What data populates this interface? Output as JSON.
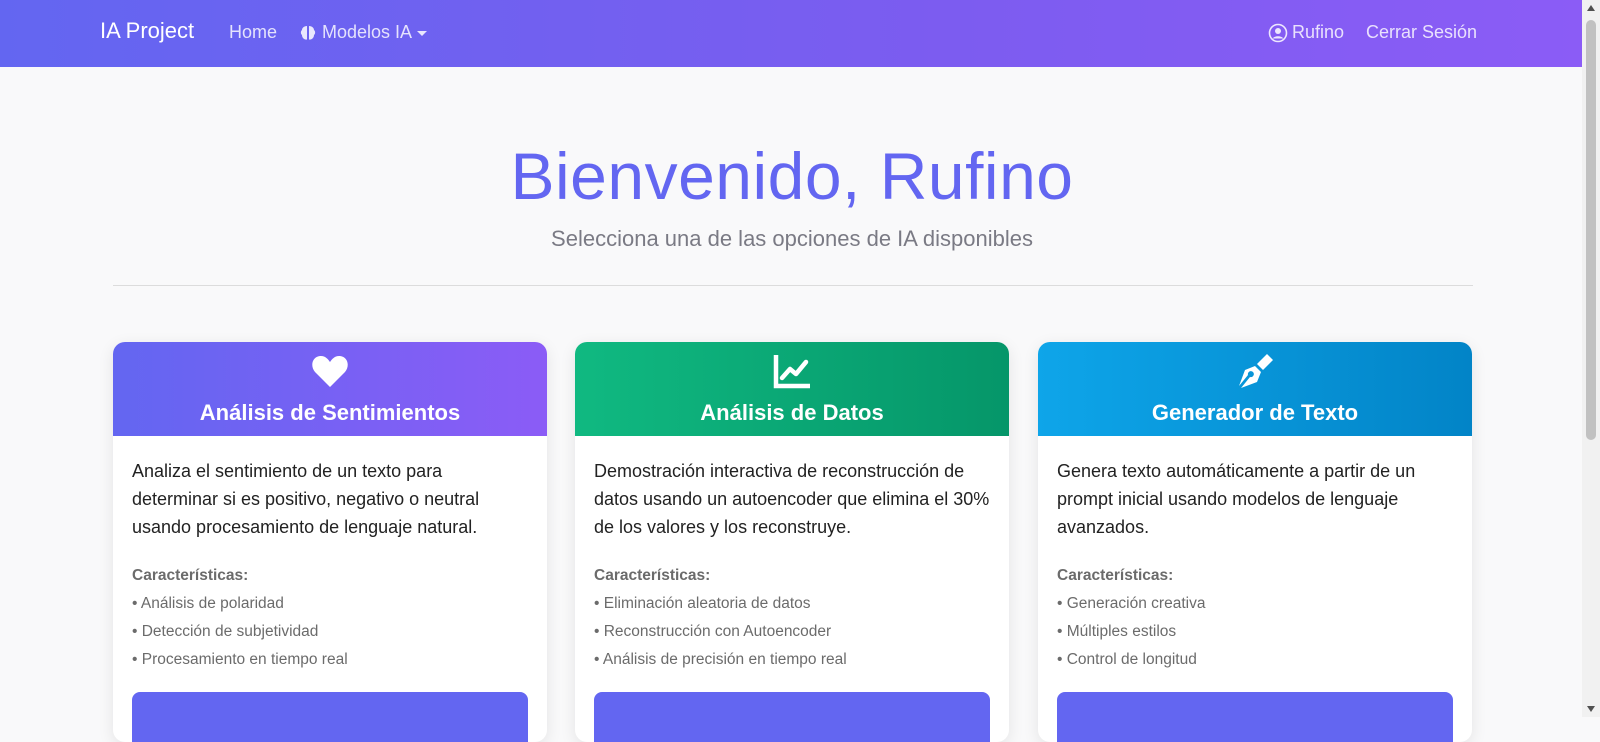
{
  "navbar": {
    "brand": "IA Project",
    "home": "Home",
    "models": "Modelos IA",
    "user": "Rufino",
    "logout": "Cerrar Sesión"
  },
  "hero": {
    "title": "Bienvenido, Rufino",
    "subtitle": "Selecciona una de las opciones de IA disponibles"
  },
  "cards": [
    {
      "icon": "heart-icon",
      "title": "Análisis de Sentimientos",
      "description": "Analiza el sentimiento de un texto para determinar si es positivo, negativo o neutral usando procesamiento de lenguaje natural.",
      "features_title": "Características:",
      "features": [
        "• Análisis de polaridad",
        "• Detección de subjetividad",
        "• Procesamiento en tiempo real"
      ],
      "color": "#6366f1"
    },
    {
      "icon": "chart-line-icon",
      "title": "Análisis de Datos",
      "description": "Demostración interactiva de reconstrucción de datos usando un autoencoder que elimina el 30% de los valores y los reconstruye.",
      "features_title": "Características:",
      "features": [
        "• Eliminación aleatoria de datos",
        "• Reconstrucción con Autoencoder",
        "• Análisis de precisión en tiempo real"
      ],
      "color": "#10b981"
    },
    {
      "icon": "pen-nib-icon",
      "title": "Generador de Texto",
      "description": "Genera texto automáticamente a partir de un prompt inicial usando modelos de lenguaje avanzados.",
      "features_title": "Características:",
      "features": [
        "• Generación creativa",
        "• Múltiples estilos",
        "• Control de longitud"
      ],
      "color": "#0ea5e9"
    }
  ]
}
